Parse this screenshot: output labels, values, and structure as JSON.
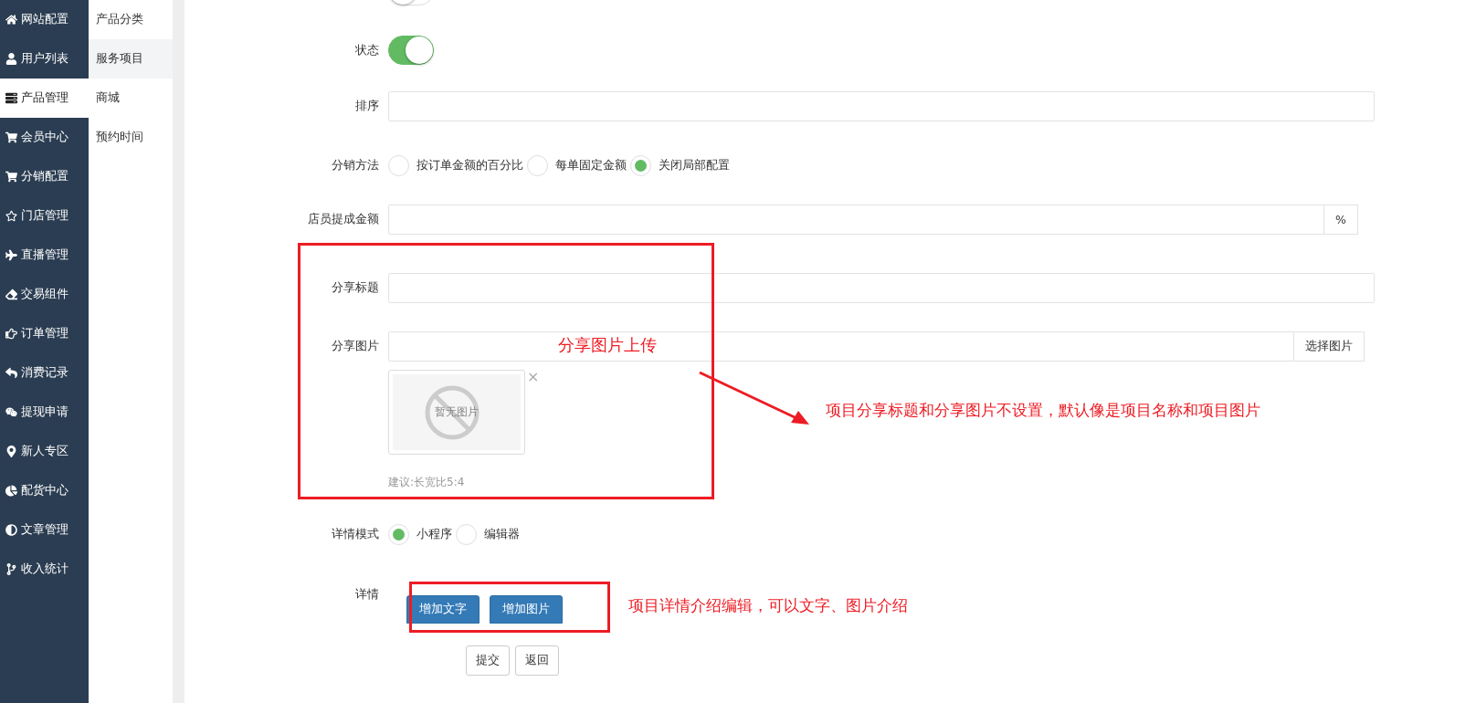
{
  "sidebar": {
    "items": [
      {
        "label": "网站配置",
        "selected": false
      },
      {
        "label": "用户列表",
        "selected": false
      },
      {
        "label": "产品管理",
        "selected": true
      },
      {
        "label": "会员中心",
        "selected": false
      },
      {
        "label": "分销配置",
        "selected": false
      },
      {
        "label": "门店管理",
        "selected": false
      },
      {
        "label": "直播管理",
        "selected": false
      },
      {
        "label": "交易组件",
        "selected": false
      },
      {
        "label": "订单管理",
        "selected": false
      },
      {
        "label": "消费记录",
        "selected": false
      },
      {
        "label": "提现申请",
        "selected": false
      },
      {
        "label": "新人专区",
        "selected": false
      },
      {
        "label": "配货中心",
        "selected": false
      },
      {
        "label": "文章管理",
        "selected": false
      },
      {
        "label": "收入统计",
        "selected": false
      }
    ]
  },
  "submenu": {
    "items": [
      {
        "label": "产品分类",
        "selected": false
      },
      {
        "label": "服务项目",
        "selected": true
      },
      {
        "label": "商城",
        "selected": false
      },
      {
        "label": "预约时间",
        "selected": false
      }
    ]
  },
  "form": {
    "top_switch": {
      "on": false
    },
    "status": {
      "label": "状态",
      "on": true
    },
    "sort": {
      "label": "排序"
    },
    "distribution": {
      "label": "分销方法",
      "options": [
        {
          "label": "按订单金额的百分比",
          "selected": false
        },
        {
          "label": "每单固定金额",
          "selected": false
        },
        {
          "label": "关闭局部配置",
          "selected": true
        }
      ]
    },
    "staff_commission": {
      "label": "店员提成金额",
      "addon": "%"
    },
    "share_title": {
      "label": "分享标题"
    },
    "share_image": {
      "label": "分享图片",
      "button": "选择图片",
      "preview_text": "暂无图片",
      "remove": "×",
      "hint": "建议:长宽比5:4"
    },
    "detail_mode": {
      "label": "详情模式",
      "options": [
        {
          "label": "小程序",
          "selected": true
        },
        {
          "label": "编辑器",
          "selected": false
        }
      ]
    },
    "detail": {
      "label": "详情",
      "buttons": [
        "增加文字",
        "增加图片"
      ]
    },
    "actions": [
      "提交",
      "返回"
    ]
  },
  "annotations": [
    {
      "text": "分享图片上传"
    },
    {
      "text": "项目分享标题和分享图片不设置，默认像是项目名称和项目图片"
    },
    {
      "text": "项目详情介绍编辑，可以文字、图片介绍"
    }
  ]
}
